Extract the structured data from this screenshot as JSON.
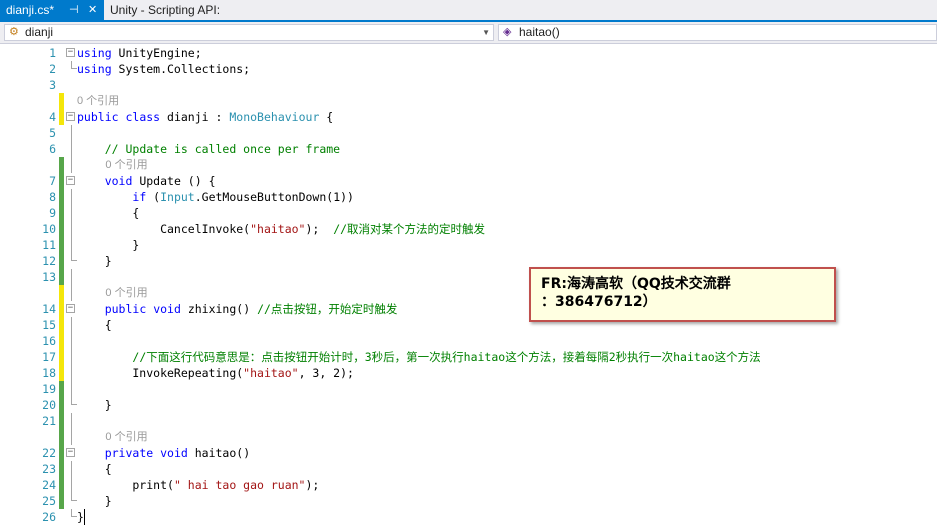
{
  "tabs": [
    {
      "label": "dianji.cs*",
      "pin": "⊣",
      "close": "✕",
      "active": true
    },
    {
      "label": "Unity - Scripting API:",
      "active": false
    }
  ],
  "nav": {
    "class_combo": {
      "icon": "class-icon",
      "value": "dianji"
    },
    "member_combo": {
      "icon": "method-icon",
      "value": "haitao()"
    }
  },
  "code": {
    "lines": [
      {
        "num": "1",
        "text": "using UnityEngine;"
      },
      {
        "num": "2",
        "text": "using System.Collections;"
      },
      {
        "num": "3",
        "text": ""
      },
      {
        "num": "4",
        "lens": "0 个引用",
        "text": "public class dianji : MonoBehaviour {"
      },
      {
        "num": "5",
        "text": ""
      },
      {
        "num": "6",
        "text": "    // Update is called once per frame"
      },
      {
        "num": "7",
        "lens": "0 个引用",
        "text": "    void Update () {"
      },
      {
        "num": "8",
        "text": "        if (Input.GetMouseButtonDown(1))"
      },
      {
        "num": "9",
        "text": "        {"
      },
      {
        "num": "10",
        "text": "            CancelInvoke(\"haitao\");  //取消对某个方法的定时触发"
      },
      {
        "num": "11",
        "text": "        }"
      },
      {
        "num": "12",
        "text": "    }"
      },
      {
        "num": "13",
        "text": ""
      },
      {
        "num": "14",
        "lens": "0 个引用",
        "text": "    public void zhixing() //点击按钮，开始定时触发"
      },
      {
        "num": "15",
        "text": "    {"
      },
      {
        "num": "16",
        "text": ""
      },
      {
        "num": "17",
        "text": "        //下面这行代码意思是：点击按钮开始计时，3秒后，第一次执行haitao这个方法，接着每隔2秒执行一次haitao这个方法"
      },
      {
        "num": "18",
        "text": "        InvokeRepeating(\"haitao\", 3, 2);"
      },
      {
        "num": "19",
        "text": ""
      },
      {
        "num": "20",
        "text": "    }"
      },
      {
        "num": "21",
        "text": ""
      },
      {
        "num": "22",
        "lens": "0 个引用",
        "text": "    private void haitao()"
      },
      {
        "num": "23",
        "text": "    {"
      },
      {
        "num": "24",
        "text": "        print(\" hai tao gao ruan\");"
      },
      {
        "num": "25",
        "text": "    }"
      },
      {
        "num": "26",
        "text": "}"
      }
    ]
  },
  "note": {
    "line1": "FR:海涛高软（QQ技术交流群",
    "line2": "：386476712）"
  },
  "colors": {
    "accent": "#007acc",
    "keyword": "#0000ff",
    "type": "#2b91af",
    "comment": "#008000",
    "string": "#a31515",
    "change_saved": "#57a64a",
    "change_unsaved": "#f4e60a",
    "note_border": "#c0504d",
    "note_bg": "#ffffe1"
  }
}
